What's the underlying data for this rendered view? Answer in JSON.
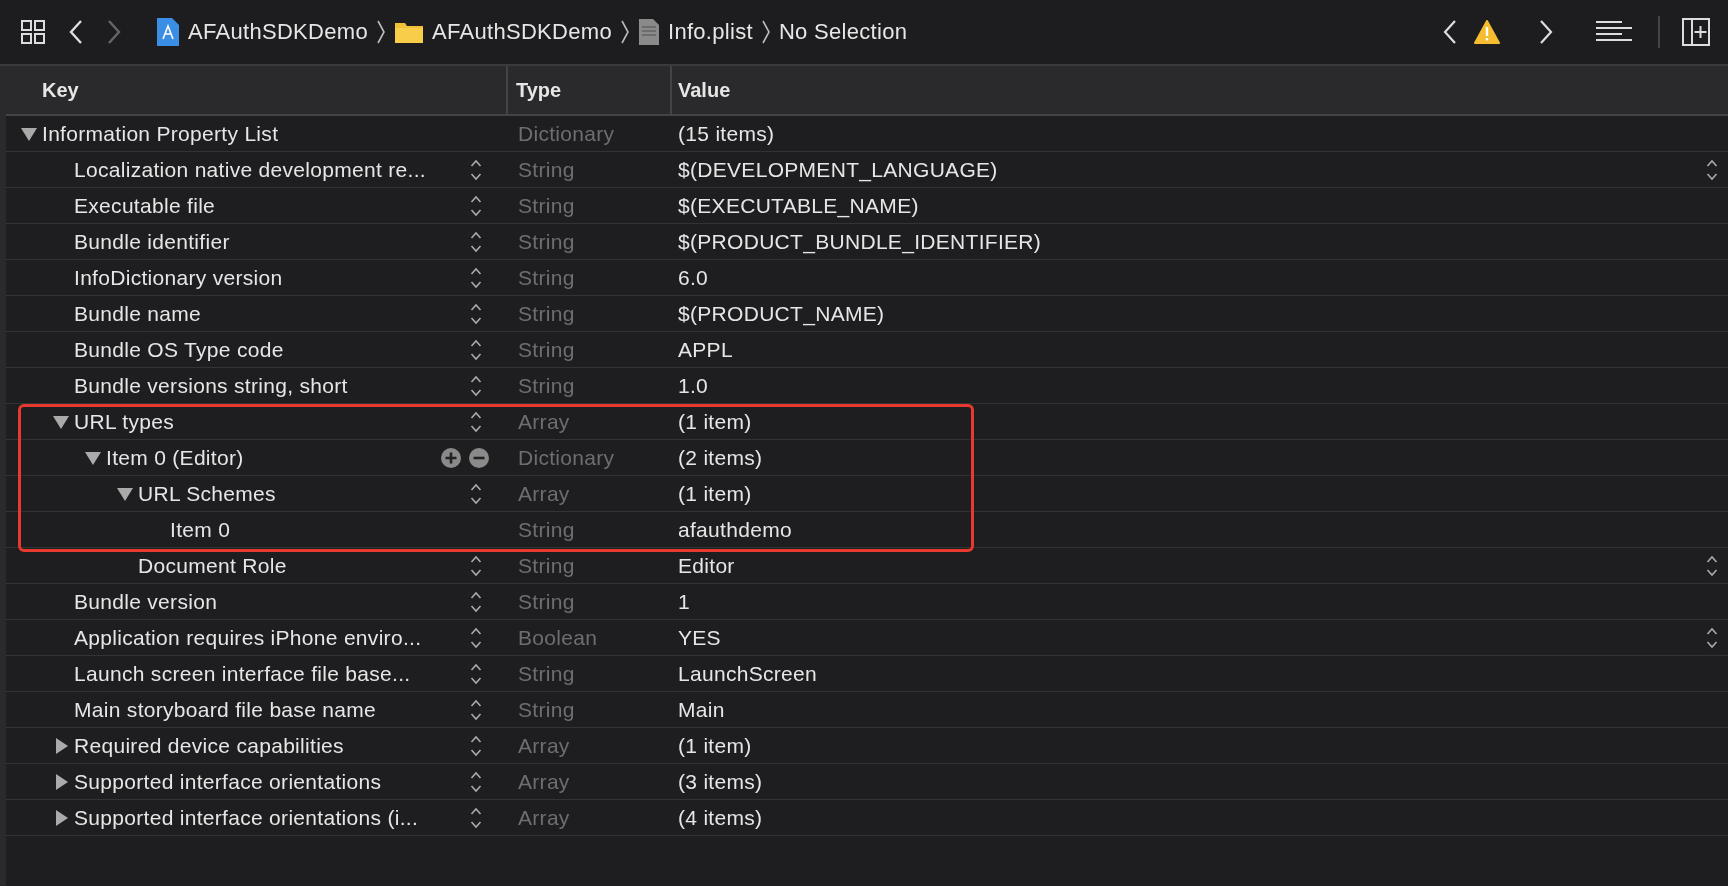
{
  "toolbar": {
    "nav": [
      {
        "kind": "back",
        "disabled": false
      },
      {
        "kind": "forward",
        "disabled": true
      }
    ],
    "breadcrumbs": [
      {
        "kind": "project",
        "label": "AFAuthSDKDemo"
      },
      {
        "kind": "folder",
        "label": "AFAuthSDKDemo"
      },
      {
        "kind": "file",
        "label": "Info.plist"
      },
      {
        "kind": "none",
        "label": "No Selection"
      }
    ]
  },
  "columns": [
    "Key",
    "Type",
    "Value"
  ],
  "rows": [
    {
      "key": "Information Property List",
      "type": "Dictionary",
      "value": "(15 items)",
      "value_menu": false,
      "outlined": false,
      "expanded": true,
      "children": [
        {
          "key": "Localization native development re...",
          "type": "String",
          "value": "$(DEVELOPMENT_LANGUAGE)",
          "kind": "stepper",
          "value_menu": true,
          "outlined": false
        },
        {
          "key": "Executable file",
          "type": "String",
          "value": "$(EXECUTABLE_NAME)",
          "kind": "stepper",
          "value_menu": false,
          "outlined": false
        },
        {
          "key": "Bundle identifier",
          "type": "String",
          "value": "$(PRODUCT_BUNDLE_IDENTIFIER)",
          "kind": "stepper",
          "value_menu": false,
          "outlined": false
        },
        {
          "key": "InfoDictionary version",
          "type": "String",
          "value": "6.0",
          "kind": "stepper",
          "value_menu": false,
          "outlined": false
        },
        {
          "key": "Bundle name",
          "type": "String",
          "value": "$(PRODUCT_NAME)",
          "kind": "stepper",
          "value_menu": false,
          "outlined": false
        },
        {
          "key": "Bundle OS Type code",
          "type": "String",
          "value": "APPL",
          "kind": "stepper",
          "value_menu": false,
          "outlined": false
        },
        {
          "key": "Bundle versions string, short",
          "type": "String",
          "value": "1.0",
          "kind": "stepper",
          "value_menu": false,
          "outlined": false
        },
        {
          "key": "URL types",
          "type": "Array",
          "value": "(1 item)",
          "kind": "stepper",
          "value_menu": false,
          "outlined": true,
          "expanded": true,
          "children": [
            {
              "key": "Item 0 (Editor)",
              "type": "Dictionary",
              "value": "(2 items)",
              "kind": "plusminus",
              "value_menu": false,
              "outlined": true,
              "expanded": true,
              "children": [
                {
                  "key": "URL Schemes",
                  "type": "Array",
                  "value": "(1 item)",
                  "kind": "stepper",
                  "value_menu": false,
                  "outlined": true,
                  "expanded": true,
                  "children": [
                    {
                      "key": "Item 0",
                      "type": "String",
                      "value": "afauthdemo",
                      "value_menu": false,
                      "outlined": true
                    }
                  ]
                },
                {
                  "key": "Document Role",
                  "type": "String",
                  "value": "Editor",
                  "kind": "stepper",
                  "value_menu": true,
                  "outlined": false
                }
              ]
            }
          ]
        },
        {
          "key": "Bundle version",
          "type": "String",
          "value": "1",
          "kind": "stepper",
          "value_menu": false,
          "outlined": false
        },
        {
          "key": "Application requires iPhone enviro...",
          "type": "Boolean",
          "value": "YES",
          "kind": "stepper",
          "value_menu": true,
          "outlined": false
        },
        {
          "key": "Launch screen interface file base...",
          "type": "String",
          "value": "LaunchScreen",
          "kind": "stepper",
          "value_menu": false,
          "outlined": false
        },
        {
          "key": "Main storyboard file base name",
          "type": "String",
          "value": "Main",
          "kind": "stepper",
          "value_menu": false,
          "outlined": false
        },
        {
          "key": "Required device capabilities",
          "type": "Array",
          "value": "(1 item)",
          "kind": "stepper",
          "value_menu": false,
          "outlined": false,
          "expanded": false
        },
        {
          "key": "Supported interface orientations",
          "type": "Array",
          "value": "(3 items)",
          "kind": "stepper",
          "value_menu": false,
          "outlined": false,
          "expanded": false
        },
        {
          "key": "Supported interface orientations (i...",
          "type": "Array",
          "value": "(4 items)",
          "kind": "stepper",
          "value_menu": false,
          "outlined": false,
          "expanded": false
        }
      ]
    }
  ]
}
